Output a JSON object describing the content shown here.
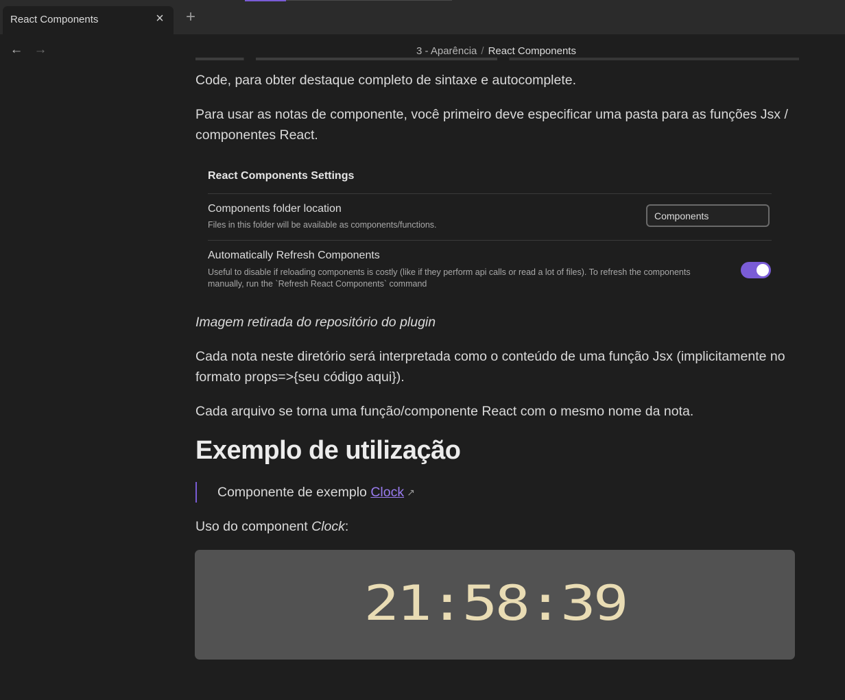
{
  "tabbar": {
    "tab_title": "React Components",
    "close_icon": "×",
    "new_tab_icon": "+"
  },
  "nav": {
    "back_icon": "←",
    "forward_icon": "→",
    "breadcrumb": {
      "folder": "3 - Aparência",
      "separator": "/",
      "current": "React Components"
    }
  },
  "content": {
    "para1": "Code, para obter destaque completo de sintaxe e autocomplete.",
    "para2": "Para usar as notas de componente, você primeiro deve especificar uma pasta para as funções Jsx / componentes React.",
    "settings": {
      "title": "React Components Settings",
      "folder_name": "Components folder location",
      "folder_desc": "Files in this folder will be available as components/functions.",
      "folder_value": "Components",
      "refresh_name": "Automatically Refresh Components",
      "refresh_desc": "Useful to disable if reloading components is costly (like if they perform api calls or read a lot of files). To refresh the components manually, run the `Refresh React Components` command",
      "refresh_enabled": true
    },
    "caption": "Imagem retirada do repositório do plugin",
    "para3": "Cada nota neste diretório será interpretada como o conteúdo de uma função Jsx (implicitamente no formato props=>{seu código aqui}).",
    "para4": "Cada arquivo se torna uma função/componente React com o mesmo nome da nota.",
    "heading": "Exemplo de utilização",
    "quote_text": "Componente de exemplo ",
    "quote_link": "Clock",
    "external_link_icon": "↗",
    "usage_prefix": "Uso do component ",
    "usage_italic": "Clock",
    "usage_suffix": ":",
    "clock_time": "21:58:39"
  },
  "colors": {
    "accent": "#7a5cd6",
    "background": "#1e1e1e",
    "clock_bg": "#525252",
    "clock_digits": "#e9dcb4"
  }
}
